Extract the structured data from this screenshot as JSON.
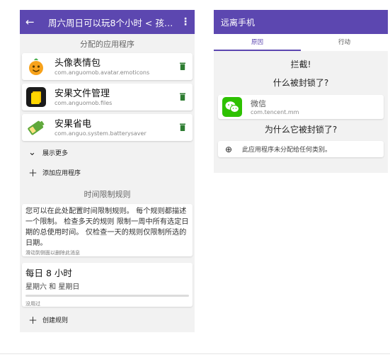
{
  "left": {
    "appbar": {
      "back_icon": "arrow-back-icon",
      "title": "周六周日可以玩8个小时 < 孩…",
      "more_icon": "more-vert-icon"
    },
    "assigned_section_title": "分配的应用程序",
    "apps": [
      {
        "name": "头像表情包",
        "package": "com.anguomob.avatar.emoticons",
        "icon": "orange-emoji-icon"
      },
      {
        "name": "安果文件管理",
        "package": "com.anguomob.files",
        "icon": "file-manager-icon"
      },
      {
        "name": "安果省电",
        "package": "com.anguo.system.batterysaver",
        "icon": "battery-saver-icon"
      }
    ],
    "show_more": {
      "icon": "chevron-down-icon",
      "label": "展示更多"
    },
    "add_app": {
      "icon": "plus-icon",
      "label": "添加应用程序"
    },
    "time_rules_section_title": "时间限制规则",
    "rule_description": "您可以在此处配置时间限制规则。 每个规则都描述一个限制。 检查多天的规则 限制一周中所有选定日期的总使用时间。 仅检查一天的规则仅限制所选的日期。",
    "rule_hint": "滑动到侧面以删除此消息",
    "rule": {
      "title": "每日 8 小时",
      "days": "星期六 和 星期日",
      "progress": 0,
      "usage": "没用过"
    },
    "create_rule": {
      "icon": "plus-icon",
      "label": "创建规则"
    }
  },
  "right": {
    "appbar_title": "远离手机",
    "tabs": [
      {
        "label": "原因"
      },
      {
        "label": "行动"
      }
    ],
    "blocked_heading": "拦截!",
    "why_blocked_heading": "什么被封锁了?",
    "blocked_app": {
      "name": "微信",
      "package": "com.tencent.mm",
      "icon": "wechat-icon"
    },
    "why_heading": "为什么它被封锁了?",
    "reason": {
      "icon": "add-circle-icon",
      "text": "此应用程序未分配给任何类别。"
    }
  },
  "colors": {
    "accent": "#5c47b0",
    "trash": "#2e7d32",
    "wechat": "#2dc100"
  }
}
